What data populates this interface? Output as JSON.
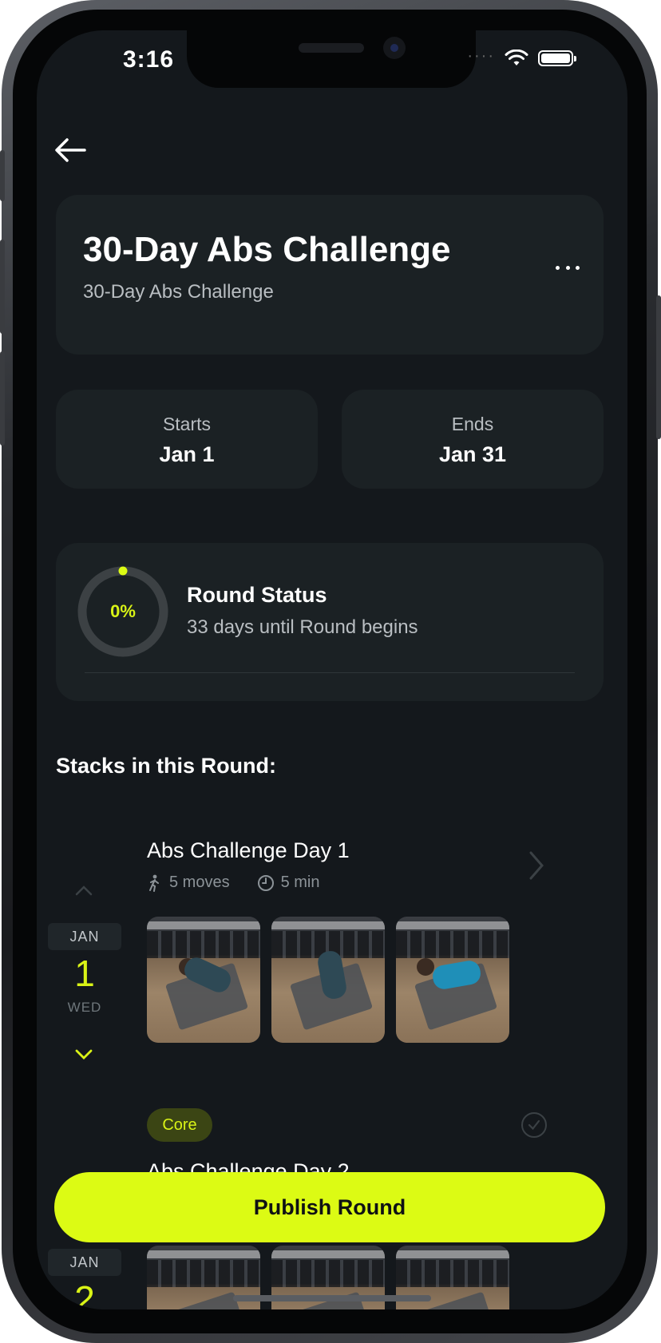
{
  "status_bar": {
    "time": "3:16"
  },
  "header": {
    "title": "30-Day Abs Challenge",
    "subtitle": "30-Day Abs Challenge"
  },
  "dates": {
    "starts": {
      "label": "Starts",
      "value": "Jan 1"
    },
    "ends": {
      "label": "Ends",
      "value": "Jan 31"
    }
  },
  "round_status": {
    "percent_text": "0%",
    "progress": 0,
    "title": "Round Status",
    "subtitle": "33 days until Round begins"
  },
  "section_title": "Stacks in this Round:",
  "stacks": [
    {
      "month": "JAN",
      "day": "1",
      "weekday": "WED",
      "title": "Abs Challenge Day 1",
      "moves": "5 moves",
      "duration": "5 min",
      "tag": "Core"
    },
    {
      "month": "JAN",
      "day": "2",
      "title": "Abs Challenge Day 2"
    }
  ],
  "publish_button": "Publish Round",
  "colors": {
    "accent": "#dcfb14",
    "background": "#14181c",
    "card": "#1b2124"
  }
}
